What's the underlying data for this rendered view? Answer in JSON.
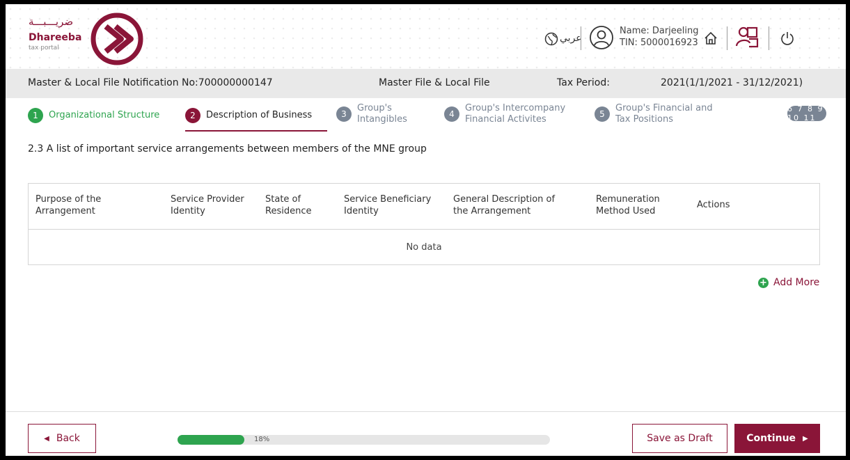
{
  "brand": {
    "arabic": "ضريـــبـــة",
    "name": "Dhareeba",
    "sub": "tax portal",
    "color": "#8a1538"
  },
  "header": {
    "language": "عربي",
    "user_name": "Name: Darjeeling",
    "user_tin": "TIN: 5000016923"
  },
  "infobar": {
    "notification": "Master & Local File Notification No:700000000147",
    "file_type": "Master File & Local File",
    "tax_period_label": "Tax Period:",
    "tax_period_value": "2021(1/1/2021 - 31/12/2021)"
  },
  "steps": [
    {
      "num": "1",
      "label": "Organizational Structure",
      "state": "done"
    },
    {
      "num": "2",
      "label": "Description of Business",
      "state": "active"
    },
    {
      "num": "3",
      "label": "Group's\nIntangibles",
      "state": "pending"
    },
    {
      "num": "4",
      "label": "Group's Intercompany\nFinancial Activites",
      "state": "pending"
    },
    {
      "num": "5",
      "label": "Group's Financial and\nTax Positions",
      "state": "pending"
    }
  ],
  "more_steps": "6 7 8 9 10 11",
  "section_title": "2.3 A list of important service arrangements between members of the MNE group",
  "table": {
    "headers": [
      "Purpose of the\nArrangement",
      "Service Provider\nIdentity",
      "State of\nResidence",
      "Service Beneficiary\nIdentity",
      "General Description of\nthe Arrangement",
      "Remuneration\nMethod Used",
      "Actions"
    ],
    "empty_text": "No data"
  },
  "add_more": "Add More",
  "footer": {
    "back": "Back",
    "progress_text": "18%",
    "progress_value": 18,
    "save_draft": "Save as Draft",
    "continue": "Continue"
  },
  "colors": {
    "accent": "#8a1538",
    "success": "#2ea44f",
    "pending": "#7a8594"
  }
}
